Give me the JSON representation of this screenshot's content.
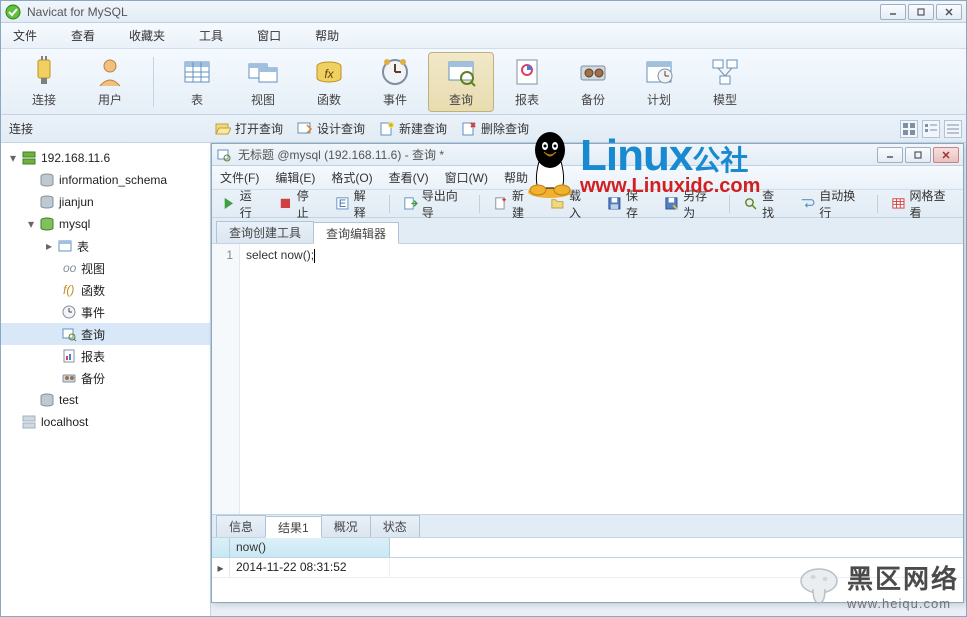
{
  "window": {
    "title": "Navicat for MySQL"
  },
  "menu": {
    "file": "文件",
    "view": "查看",
    "fav": "收藏夹",
    "tools": "工具",
    "window": "窗口",
    "help": "帮助"
  },
  "toolbar": {
    "connect": "连接",
    "user": "用户",
    "table": "表",
    "view": "视图",
    "func": "函数",
    "event": "事件",
    "query": "查询",
    "report": "报表",
    "backup": "备份",
    "plan": "计划",
    "model": "模型"
  },
  "second_row": {
    "left_label": "连接",
    "open_query": "打开查询",
    "design_query": "设计查询",
    "new_query": "新建查询",
    "delete_query": "删除查询"
  },
  "tree": {
    "conn1": "192.168.11.6",
    "db_info": "information_schema",
    "db_jianjun": "jianjun",
    "db_mysql": "mysql",
    "m_table": "表",
    "m_view": "视图",
    "m_func": "函数",
    "m_event": "事件",
    "m_query": "查询",
    "m_report": "报表",
    "m_backup": "备份",
    "db_test": "test",
    "conn2": "localhost"
  },
  "mdi": {
    "title": "无标题 @mysql (192.168.11.6) - 查询 *",
    "menu": {
      "file": "文件(F)",
      "edit": "编辑(E)",
      "format": "格式(O)",
      "view": "查看(V)",
      "window": "窗口(W)",
      "help": "帮助"
    },
    "tb": {
      "run": "运行",
      "stop": "停止",
      "explain": "解释",
      "export": "导出向导",
      "new": "新建",
      "load": "载入",
      "save": "保存",
      "save_as": "另存为",
      "find": "查找",
      "wrap": "自动换行",
      "gridview": "网格查看"
    },
    "tabs": {
      "builder": "查询创建工具",
      "editor": "查询编辑器"
    },
    "editor": {
      "line_no": "1",
      "code": "select now();"
    },
    "result_tabs": {
      "info": "信息",
      "result1": "结果1",
      "profile": "概况",
      "status": "状态"
    },
    "result": {
      "col1": "now()",
      "row1_col1": "2014-11-22 08:31:52"
    }
  },
  "watermark": {
    "linux_big": "Linux",
    "linux_cn": "公社",
    "linux_url": "www.Linuxidc.com",
    "heiou_big": "黑区网络",
    "heiou_url": "www.heiqu.com"
  }
}
